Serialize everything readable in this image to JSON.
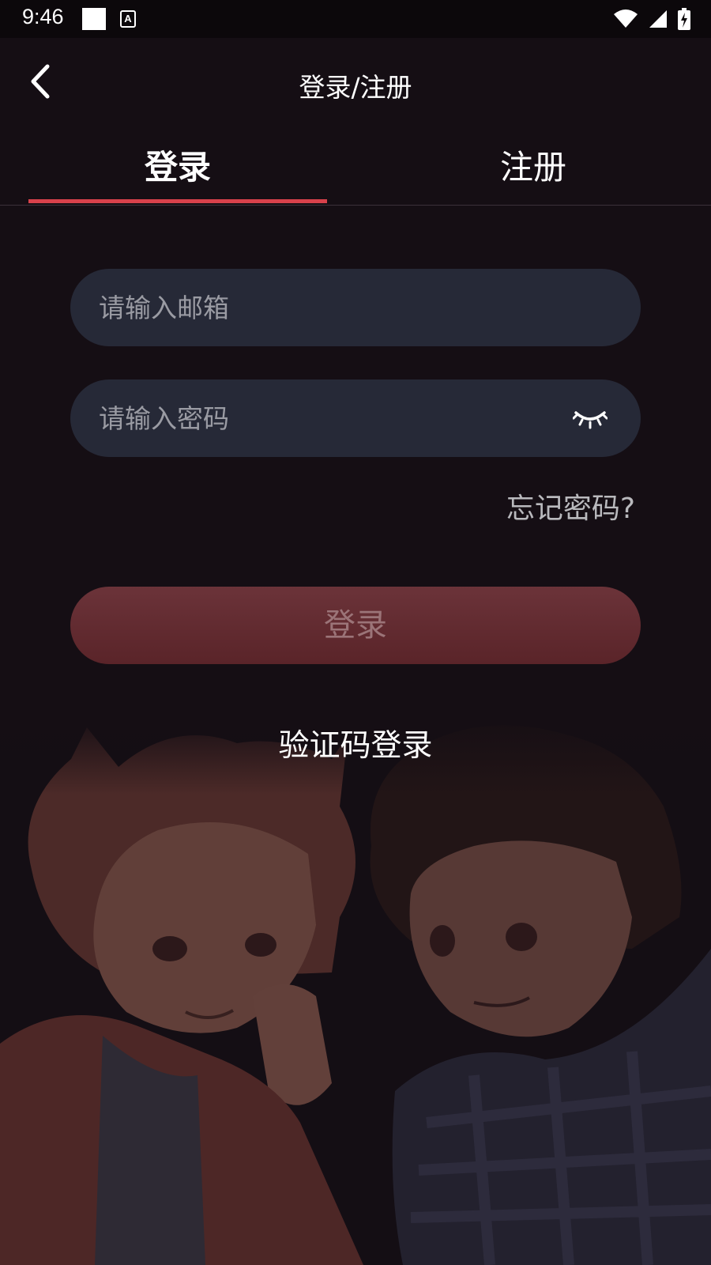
{
  "status_bar": {
    "time": "9:46",
    "a_icon_text": "A",
    "icons": [
      "notification-square-icon",
      "a-indicator-icon",
      "wifi-icon",
      "signal-icon",
      "battery-charging-icon"
    ]
  },
  "header": {
    "title": "登录/注册",
    "back_icon": "chevron-left-icon"
  },
  "tabs": {
    "items": [
      {
        "label": "登录",
        "active": true
      },
      {
        "label": "注册",
        "active": false
      }
    ],
    "indicator_color": "#d8414b"
  },
  "form": {
    "email": {
      "value": "",
      "placeholder": "请输入邮箱"
    },
    "password": {
      "value": "",
      "placeholder": "请输入密码",
      "toggle_icon": "eye-closed-icon"
    },
    "forgot_label": "忘记密码?",
    "submit_label": "登录",
    "code_login_label": "验证码登录"
  },
  "colors": {
    "background": "#150e14",
    "input_background": "#262937",
    "button_background": "#5e282e",
    "accent": "#d8414b"
  },
  "background_image": "illustration-two-anime-boys"
}
